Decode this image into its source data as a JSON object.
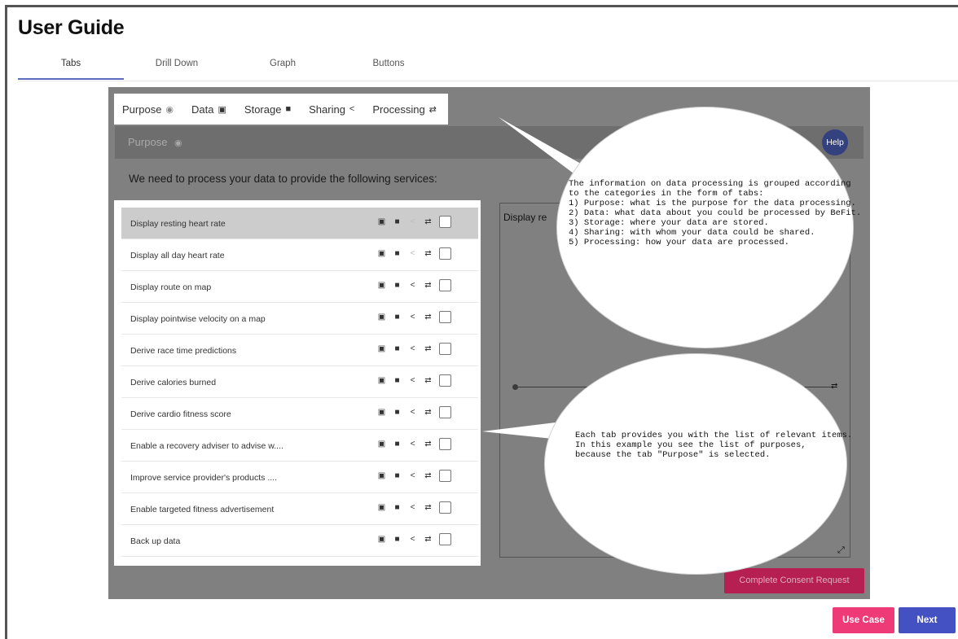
{
  "page": {
    "title": "User Guide"
  },
  "guide_tabs": [
    {
      "label": "Tabs",
      "active": true
    },
    {
      "label": "Drill Down",
      "active": false
    },
    {
      "label": "Graph",
      "active": false
    },
    {
      "label": "Buttons",
      "active": false
    }
  ],
  "inner_tabs": [
    {
      "label": "Purpose",
      "icon": "target-icon",
      "glyph": "◉"
    },
    {
      "label": "Data",
      "icon": "id-card-icon",
      "glyph": "▣"
    },
    {
      "label": "Storage",
      "icon": "archive-box-icon",
      "glyph": "■"
    },
    {
      "label": "Sharing",
      "icon": "share-icon",
      "glyph": "<"
    },
    {
      "label": "Processing",
      "icon": "retweet-icon",
      "glyph": "⇄"
    }
  ],
  "purpose_header": {
    "label": "Purpose",
    "glyph": "◉"
  },
  "help_label": "Help",
  "services_heading": "We need to process your data to provide the following services:",
  "purposes": [
    {
      "label": "Display resting heart rate",
      "selected": true,
      "sharing_dim": true
    },
    {
      "label": "Display all day heart rate",
      "selected": false,
      "sharing_dim": true
    },
    {
      "label": "Display route on map",
      "selected": false,
      "sharing_dim": false
    },
    {
      "label": "Display pointwise velocity on a map",
      "selected": false,
      "sharing_dim": false
    },
    {
      "label": "Derive race time predictions",
      "selected": false,
      "sharing_dim": false
    },
    {
      "label": "Derive calories burned",
      "selected": false,
      "sharing_dim": false
    },
    {
      "label": "Derive cardio fitness score",
      "selected": false,
      "sharing_dim": false
    },
    {
      "label": "Enable a recovery adviser to advise w....",
      "selected": false,
      "sharing_dim": false
    },
    {
      "label": "Improve service provider's products ....",
      "selected": false,
      "sharing_dim": false
    },
    {
      "label": "Enable targeted fitness advertisement",
      "selected": false,
      "sharing_dim": false
    },
    {
      "label": "Back up data",
      "selected": false,
      "sharing_dim": false
    }
  ],
  "row_icon_glyphs": {
    "data": "▣",
    "storage": "■",
    "sharing": "<",
    "processing": "⇄"
  },
  "graph": {
    "title": "Display re",
    "end_glyph": "⇄",
    "expand_glyph": "⤢"
  },
  "complete_button": "Complete Consent Request",
  "bubble_tabs_text": "The information on data processing is grouped according\nto the categories in the form of tabs:\n1) Purpose: what is the purpose for the data processing.\n2) Data: what data about you could be processed by BeFit.\n3) Storage: where your data are stored.\n4) Sharing: with whom your data could be shared.\n5) Processing: how your data are processed.",
  "bubble_list_text": "Each tab provides you with the list of relevant items.\nIn this example you see the list of purposes,\nbecause the tab \"Purpose\" is selected.",
  "footer": {
    "use_case": "Use Case",
    "next": "Next"
  },
  "colors": {
    "accent": "#4451c2",
    "use_case": "#ee3a77",
    "complete": "#b51f52",
    "help": "#34417f"
  }
}
